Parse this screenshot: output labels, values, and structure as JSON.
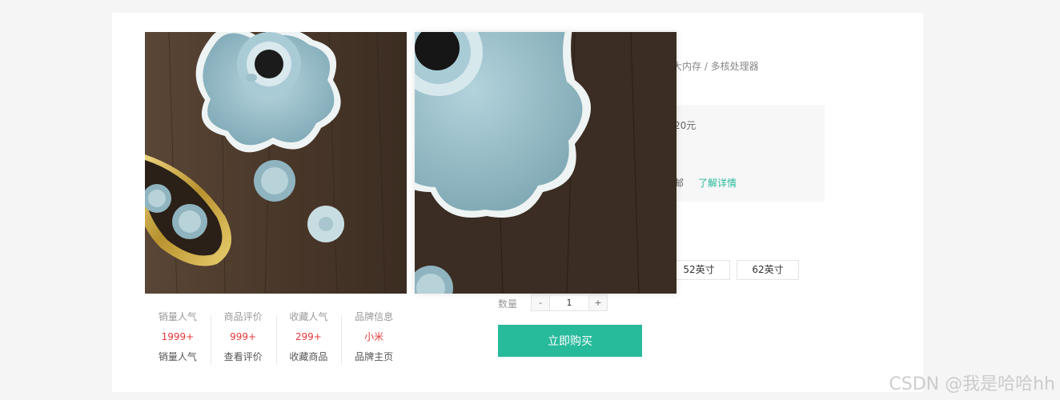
{
  "product": {
    "spec_fragment": "大内存 / 多核处理器",
    "price_fragment": "20元",
    "shipping_fragment": "邮",
    "detail_link": "了解详情"
  },
  "stats": [
    {
      "title": "销量人气",
      "value": "1999+",
      "link": "销量人气"
    },
    {
      "title": "商品评价",
      "value": "999+",
      "link": "查看评价"
    },
    {
      "title": "收藏人气",
      "value": "299+",
      "link": "收藏商品"
    },
    {
      "title": "品牌信息",
      "value": "小米",
      "link": "品牌主页"
    }
  ],
  "sizes": {
    "s52": "52英寸",
    "s62": "62英寸"
  },
  "quantity": {
    "label": "数量",
    "minus": "-",
    "plus": "+",
    "value": "1"
  },
  "buy_label": "立即购买",
  "watermark": "CSDN @我是哈哈hh"
}
